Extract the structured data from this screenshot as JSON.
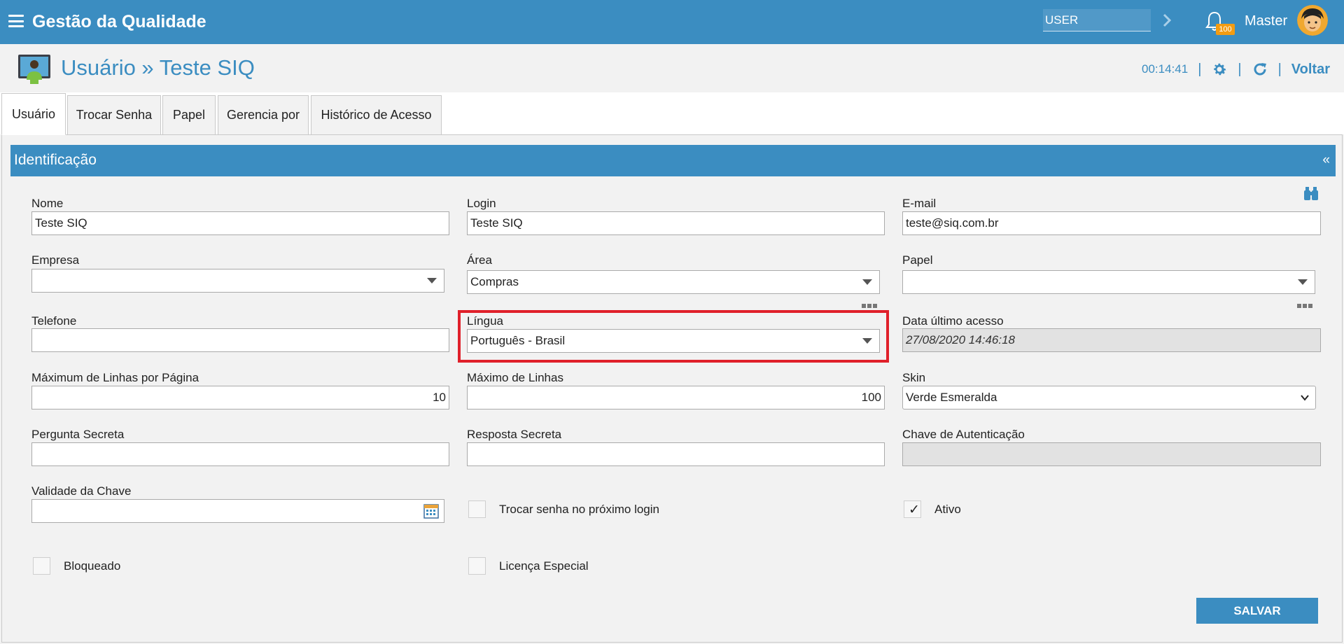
{
  "topbar": {
    "app_title": "Gestão da Qualidade",
    "user_search_placeholder": "USER",
    "notification_count": "100",
    "user_name": "Master"
  },
  "page": {
    "title": "Usuário » Teste SIQ",
    "timer": "00:14:41",
    "back_label": "Voltar"
  },
  "tabs": [
    {
      "label": "Usuário"
    },
    {
      "label": "Trocar Senha"
    },
    {
      "label": "Papel"
    },
    {
      "label": "Gerencia por"
    },
    {
      "label": "Histórico de Acesso"
    }
  ],
  "section": {
    "title": "Identificação",
    "collapse_glyph": "«"
  },
  "form": {
    "nome": {
      "label": "Nome",
      "value": "Teste SIQ"
    },
    "login": {
      "label": "Login",
      "value": "Teste SIQ"
    },
    "email": {
      "label": "E-mail",
      "value": "teste@siq.com.br"
    },
    "empresa": {
      "label": "Empresa",
      "value": ""
    },
    "area": {
      "label": "Área",
      "value": "Compras"
    },
    "papel": {
      "label": "Papel",
      "value": ""
    },
    "telefone": {
      "label": "Telefone",
      "value": ""
    },
    "lingua": {
      "label": "Língua",
      "value": "Português - Brasil"
    },
    "data_ultimo_acesso": {
      "label": "Data último acesso",
      "value": "27/08/2020 14:46:18"
    },
    "max_linhas_pagina": {
      "label": "Máximum de Linhas por Página",
      "value": "10"
    },
    "max_linhas": {
      "label": "Máximo de Linhas",
      "value": "100"
    },
    "skin": {
      "label": "Skin",
      "value": "Verde Esmeralda"
    },
    "pergunta_secreta": {
      "label": "Pergunta Secreta",
      "value": ""
    },
    "resposta_secreta": {
      "label": "Resposta Secreta",
      "value": ""
    },
    "chave_autenticacao": {
      "label": "Chave de Autenticação",
      "value": ""
    },
    "validade_chave": {
      "label": "Validade da Chave",
      "value": ""
    },
    "trocar_senha": {
      "label": "Trocar senha no próximo login",
      "checked": false
    },
    "ativo": {
      "label": "Ativo",
      "checked": true
    },
    "bloqueado": {
      "label": "Bloqueado",
      "checked": false
    },
    "licenca_especial": {
      "label": "Licença Especial",
      "checked": false
    },
    "check_glyph": "✓",
    "save_label": "SALVAR"
  },
  "colors": {
    "brand": "#3b8dc1",
    "highlight": "#e0202a",
    "badge": "#f39c12"
  },
  "icons": [
    "hamburger-menu-icon",
    "chevron-right-icon",
    "bell-icon",
    "avatar",
    "monitor-user-icon",
    "gear-icon",
    "refresh-icon",
    "binoculars-icon",
    "calendar-icon",
    "ellipsis-icon"
  ]
}
